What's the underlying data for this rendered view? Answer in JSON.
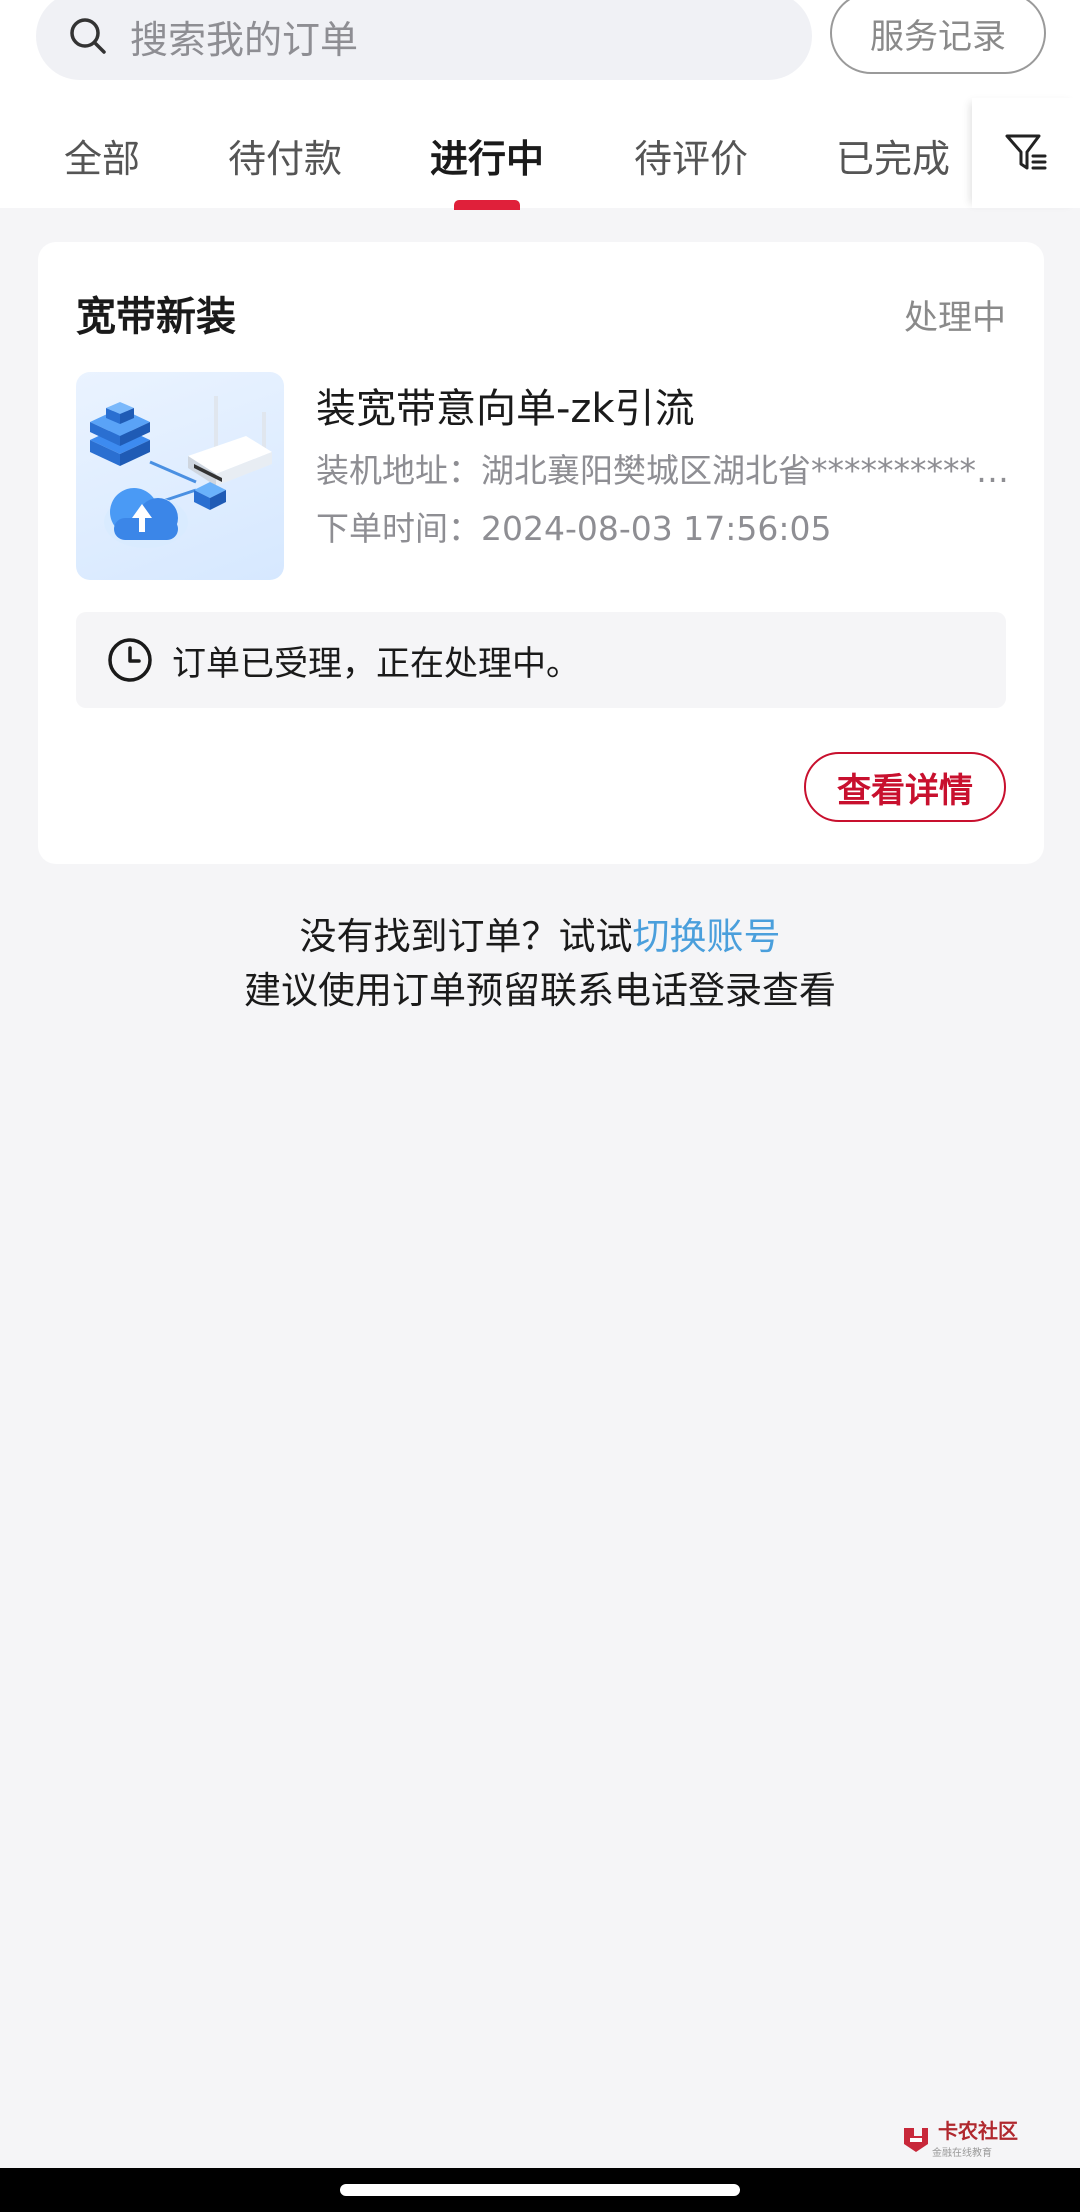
{
  "search": {
    "placeholder": "搜索我的订单",
    "icon": "search-icon"
  },
  "header": {
    "service_records_label": "服务记录"
  },
  "tabs": [
    {
      "label": "全部",
      "active": false
    },
    {
      "label": "待付款",
      "active": false
    },
    {
      "label": "进行中",
      "active": true
    },
    {
      "label": "待评价",
      "active": false
    },
    {
      "label": "已完成",
      "active": false
    }
  ],
  "filter": {
    "icon": "filter-icon"
  },
  "order": {
    "category": "宽带新装",
    "status": "处理中",
    "product_name": "装宽带意向单-zk引流",
    "address_label": "装机地址：",
    "address_value": "湖北襄阳樊城区湖北省**********…",
    "time_label": "下单时间：",
    "time_value": "2024-08-03 17:56:05",
    "notice": "订单已受理，正在处理中。",
    "detail_button": "查看详情"
  },
  "hint": {
    "line1_prefix": "没有找到订单？试试",
    "line1_link": "切换账号",
    "line2": "建议使用订单预留联系电话登录查看"
  },
  "watermark": {
    "title": "卡农社区",
    "subtitle": "金融在线教育"
  },
  "colors": {
    "accent_red": "#e0203a",
    "button_red": "#c8102e",
    "link_blue": "#4a9fdc",
    "page_bg": "#f5f5f7"
  }
}
